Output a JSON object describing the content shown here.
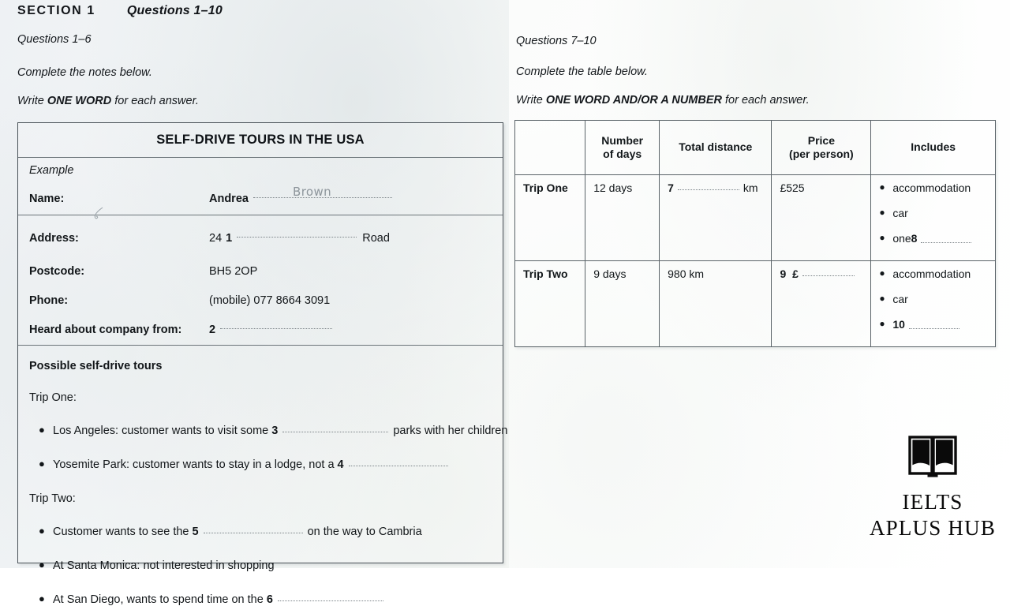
{
  "header": {
    "section_label": "SECTION 1",
    "section_questions": "Questions 1–10"
  },
  "left_column": {
    "questions_range": "Questions 1–6",
    "instruction_1": "Complete the notes below.",
    "instruction_2_pre": "Write ",
    "instruction_2_bold": "ONE WORD",
    "instruction_2_post": " for each answer.",
    "notes": {
      "title": "SELF-DRIVE TOURS IN THE USA",
      "example_label": "Example",
      "name_label": "Name:",
      "name_value": "Andrea",
      "name_handwritten": "Brown",
      "address_label": "Address:",
      "address_value_pre": "24",
      "address_q": "1",
      "address_value_post": "Road",
      "postcode_label": "Postcode:",
      "postcode_value": "BH5 2OP",
      "phone_label": "Phone:",
      "phone_value": "(mobile) 077 8664 3091",
      "heard_label": "Heard about company from:",
      "heard_q": "2",
      "tours_heading": "Possible self-drive tours",
      "trip_one_label": "Trip One:",
      "trip_one_bullets": [
        {
          "pre": "Los Angeles: customer wants to visit some ",
          "q": "3",
          "post": "parks with her children"
        },
        {
          "pre": "Yosemite Park: customer wants to stay in a lodge, not a ",
          "q": "4",
          "post": ""
        }
      ],
      "trip_two_label": "Trip Two:",
      "trip_two_bullets": [
        {
          "pre": "Customer wants to see the ",
          "q": "5",
          "post": "on the way to Cambria"
        },
        {
          "pre": "At Santa Monica: not interested in shopping",
          "q": "",
          "post": ""
        },
        {
          "pre": "At San Diego, wants to spend time on the ",
          "q": "6",
          "post": ""
        }
      ]
    }
  },
  "right_column": {
    "questions_range": "Questions 7–10",
    "instruction_1": "Complete the table below.",
    "instruction_2_pre": "Write ",
    "instruction_2_bold": "ONE WORD AND/OR A NUMBER",
    "instruction_2_post": " for each answer.",
    "table": {
      "headers": [
        "",
        "Number\nof days",
        "Total distance",
        "Price\n(per person)",
        "Includes"
      ],
      "header_corner": "",
      "header_days_line1": "Number",
      "header_days_line2": "of days",
      "header_distance": "Total distance",
      "header_price_line1": "Price",
      "header_price_line2": "(per person)",
      "header_includes": "Includes",
      "rows": [
        {
          "label": "Trip One",
          "days": "12 days",
          "distance_q": "7",
          "distance_unit": "km",
          "distance_value": "",
          "price": "£525",
          "price_q": "",
          "includes": [
            {
              "text": "accommodation",
              "q": ""
            },
            {
              "text": "car",
              "q": ""
            },
            {
              "text": "one ",
              "q": "8"
            }
          ]
        },
        {
          "label": "Trip Two",
          "days": "9 days",
          "distance_q": "",
          "distance_unit": "",
          "distance_value": "980 km",
          "price": "",
          "price_q": "9",
          "price_currency": "£",
          "includes": [
            {
              "text": "accommodation",
              "q": ""
            },
            {
              "text": "car",
              "q": ""
            },
            {
              "text": "",
              "q": "10"
            }
          ]
        }
      ]
    }
  },
  "logo": {
    "icon": "open-book-icon",
    "line1": "IELTS",
    "line2": "APLUS HUB"
  },
  "colors": {
    "ink": "#12171a",
    "border": "#5a6368",
    "handwriting": "#8d959b",
    "page_left_bg": "#eef1f4",
    "page_right_bg": "#fdfefd"
  }
}
